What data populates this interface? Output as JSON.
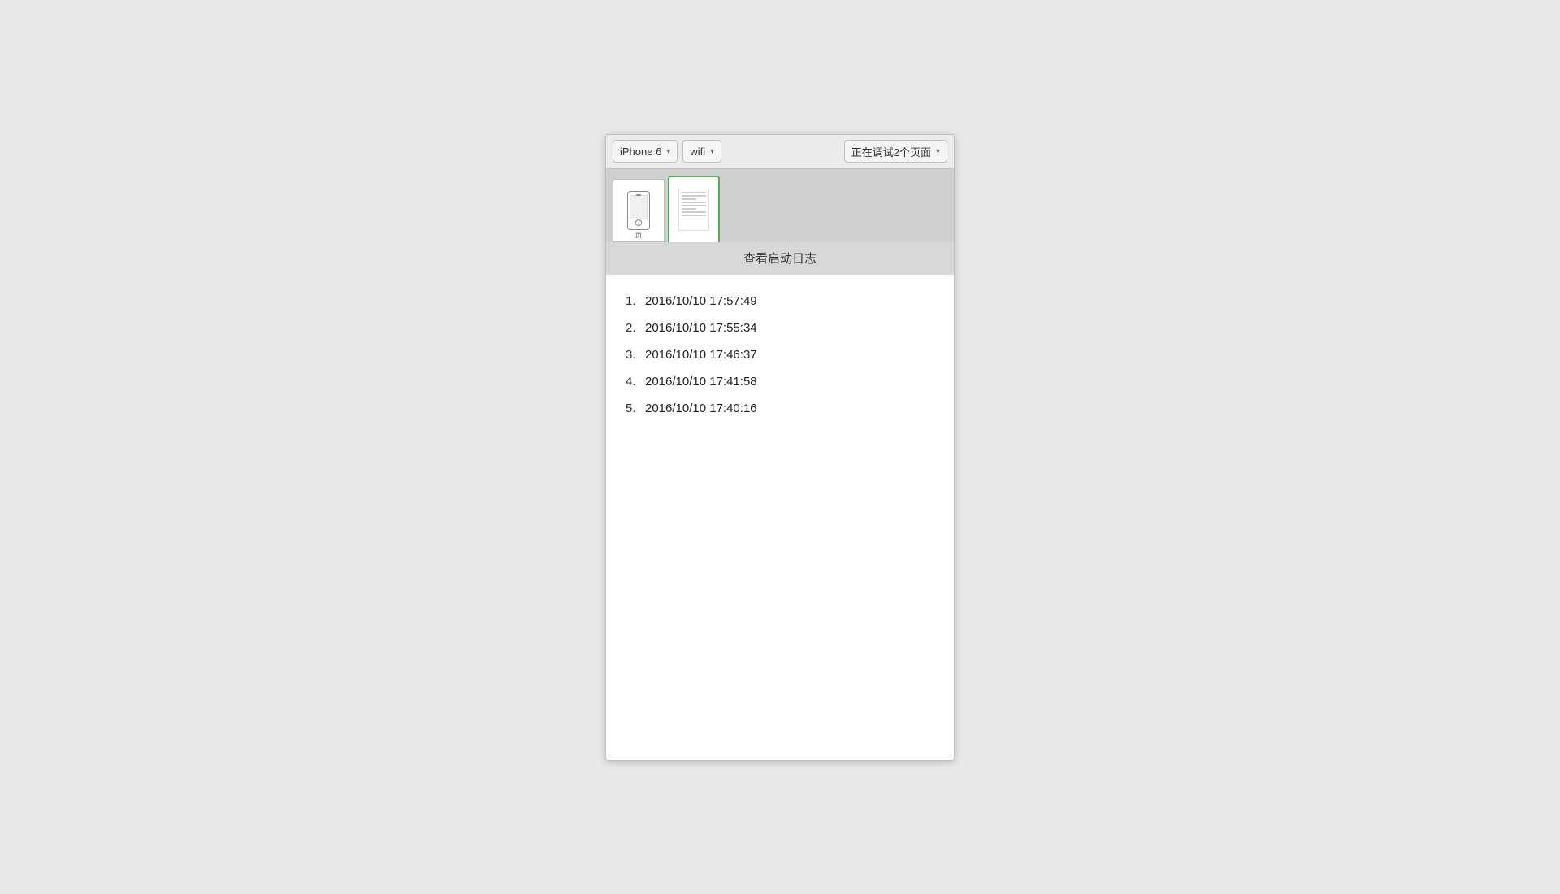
{
  "toolbar": {
    "device_label": "iPhone 6",
    "network_label": "wifi",
    "status_label": "正在调试2个页面",
    "device_chevron": "▾",
    "network_chevron": "▾",
    "status_chevron": "▾"
  },
  "tabs": [
    {
      "id": "tab-1",
      "label": "页面",
      "active": false
    },
    {
      "id": "tab-2",
      "label": "",
      "active": true
    }
  ],
  "section": {
    "title": "查看启动日志"
  },
  "log_entries": [
    {
      "number": "1.",
      "timestamp": "2016/10/10 17:57:49"
    },
    {
      "number": "2.",
      "timestamp": "2016/10/10 17:55:34"
    },
    {
      "number": "3.",
      "timestamp": "2016/10/10 17:46:37"
    },
    {
      "number": "4.",
      "timestamp": "2016/10/10 17:41:58"
    },
    {
      "number": "5.",
      "timestamp": "2016/10/10 17:40:16"
    }
  ]
}
